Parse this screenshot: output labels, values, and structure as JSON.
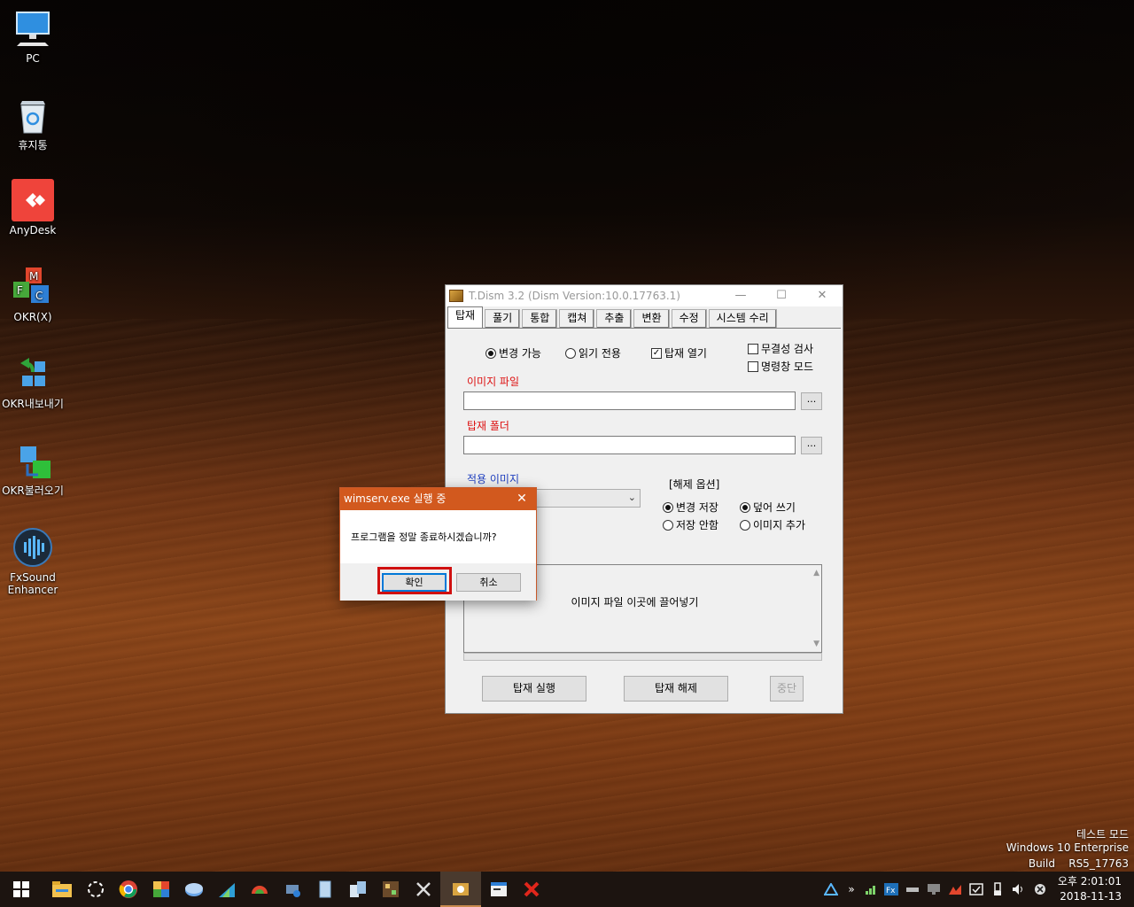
{
  "desktop": {
    "icons": [
      {
        "label": "PC"
      },
      {
        "label": "휴지통"
      },
      {
        "label": "AnyDesk"
      },
      {
        "label": "OKR(X)"
      },
      {
        "label": "OKR내보내기"
      },
      {
        "label": "OKR불러오기"
      },
      {
        "label": "FxSound\nEnhancer"
      }
    ],
    "watermark": {
      "line1": "테스트 모드",
      "line2": "Windows 10 Enterprise",
      "line3": "Build    RS5_17763"
    }
  },
  "tdism": {
    "title": "T.Dism 3.2 (Dism Version:10.0.17763.1)",
    "tabs": [
      "탑재",
      "풀기",
      "통합",
      "캡쳐",
      "추출",
      "변환",
      "수정",
      "시스템 수리"
    ],
    "options": {
      "rw": "변경 가능",
      "ro": "읽기 전용",
      "open_mount": "탑재 열기",
      "integrity": "무결성 검사",
      "cmd_mode": "명령창 모드"
    },
    "image_file_label": "이미지 파일",
    "image_file_value": "",
    "mount_folder_label": "탑재 폴더",
    "mount_folder_value": "",
    "browse_label": "...",
    "apply_image_label": "적용 이미지",
    "unmount_options_label": "[해제 옵션]",
    "unmount": {
      "save": "변경 저장",
      "discard": "저장 안함",
      "overwrite": "덮어 쓰기",
      "append": "이미지 추가"
    },
    "drop_text": "이미지 파일 이곳에 끌어넣기",
    "buttons": {
      "mount": "탑재 실행",
      "unmount": "탑재 해제",
      "stop": "중단"
    }
  },
  "dialog": {
    "title": "wimserv.exe 실행 중",
    "message": "프로그램을 정말 종료하시겠습니까?",
    "ok": "확인",
    "cancel": "취소"
  },
  "taskbar": {
    "clock_line1": "오후 2:01:01",
    "clock_line2": "2018-11-13",
    "tray_chevron": "»"
  },
  "colors": {
    "dialog_title": "#d2591e",
    "label_red": "#dd1111",
    "label_blue": "#1f3fbf",
    "highlight": "#d01010"
  }
}
